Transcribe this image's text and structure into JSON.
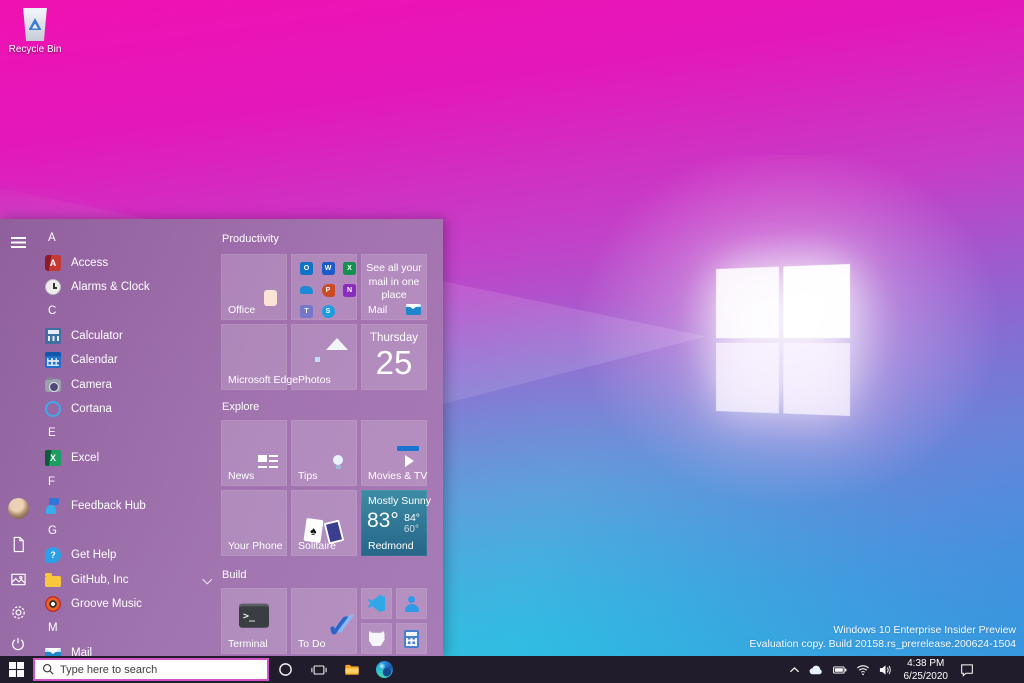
{
  "desktop": {
    "recycle_bin_label": "Recycle Bin",
    "watermark": {
      "line1": "Windows 10 Enterprise Insider Preview",
      "line2": "Evaluation copy. Build 20158.rs_prerelease.200624-1504"
    }
  },
  "start_menu": {
    "app_list": [
      {
        "label": "A"
      },
      {
        "label": "Access"
      },
      {
        "label": "Alarms & Clock"
      },
      {
        "label": "C"
      },
      {
        "label": "Calculator"
      },
      {
        "label": "Calendar"
      },
      {
        "label": "Camera"
      },
      {
        "label": "Cortana"
      },
      {
        "label": "E"
      },
      {
        "label": "Excel"
      },
      {
        "label": "F"
      },
      {
        "label": "Feedback Hub"
      },
      {
        "label": "G"
      },
      {
        "label": "Get Help"
      },
      {
        "label": "GitHub, Inc"
      },
      {
        "label": "Groove Music"
      },
      {
        "label": "M"
      },
      {
        "label": "Mail"
      }
    ],
    "section_productivity": "Productivity",
    "section_explore": "Explore",
    "section_build": "Build",
    "tiles": {
      "office_label": "Office",
      "mail_text": "See all your mail in one place",
      "mail_label": "Mail",
      "edge_label": "Microsoft Edge",
      "photos_label": "Photos",
      "calendar_day": "Thursday",
      "calendar_date": "25",
      "news_label": "News",
      "tips_label": "Tips",
      "movies_label": "Movies & TV",
      "phone_label": "Your Phone",
      "solitaire_label": "Solitaire",
      "weather": {
        "condition": "Mostly Sunny",
        "temp": "83°",
        "high": "84°",
        "low": "60°",
        "location": "Redmond"
      },
      "terminal_label": "Terminal",
      "todo_label": "To Do"
    }
  },
  "taskbar": {
    "search_placeholder": "Type here to search",
    "clock_time": "4:38 PM",
    "clock_date": "6/25/2020"
  },
  "colors": {
    "accent_magenta": "#cf52c6",
    "wallpaper_top": "#f011b2",
    "wallpaper_bottom_left": "#1ae6aa",
    "wallpaper_bottom_right": "#3468dc",
    "start_menu_bg": "#9a6da9",
    "taskbar_bg": "#201c2b",
    "weather_tile": "#2f7695"
  }
}
